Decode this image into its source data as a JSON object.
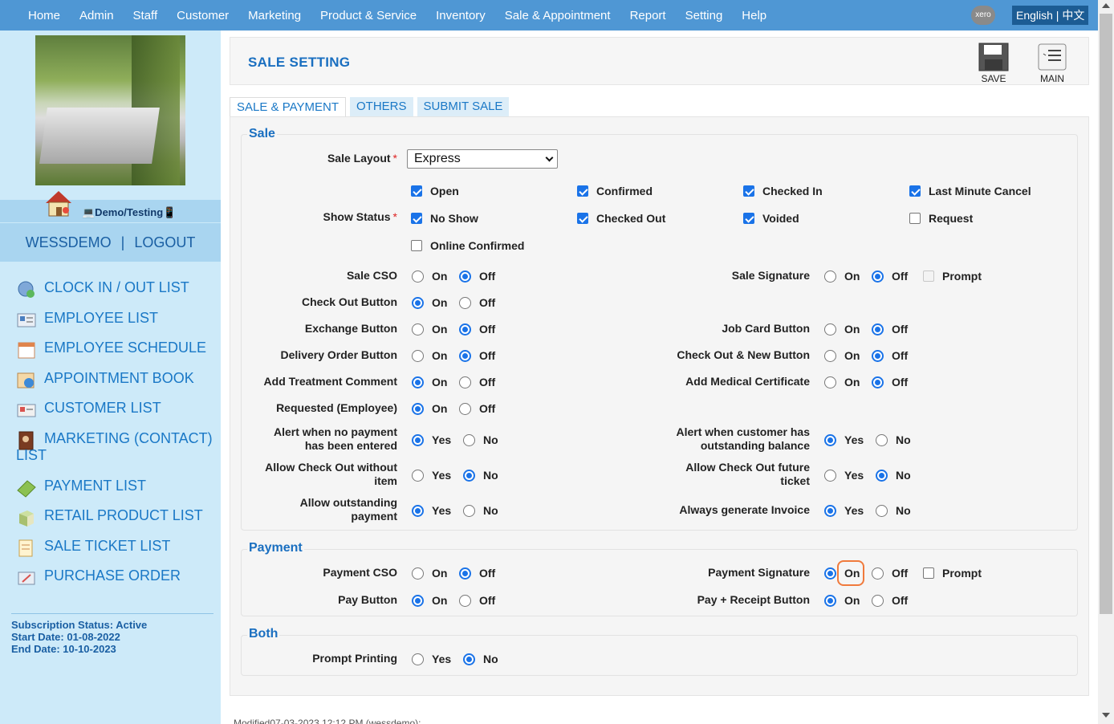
{
  "nav": {
    "items": [
      "Home",
      "Admin",
      "Staff",
      "Customer",
      "Marketing",
      "Product & Service",
      "Inventory",
      "Sale & Appointment",
      "Report",
      "Setting",
      "Help"
    ],
    "xero": "xero",
    "language": "English | 中文"
  },
  "sidebar": {
    "demo_label": "💻Demo/Testing📱",
    "user": "WESSDEMO",
    "separator": "|",
    "logout": "LOGOUT",
    "menu": [
      "CLOCK IN / OUT LIST",
      "EMPLOYEE LIST",
      "EMPLOYEE SCHEDULE",
      "APPOINTMENT BOOK",
      "CUSTOMER LIST",
      "MARKETING (CONTACT) LIST",
      "PAYMENT LIST",
      "RETAIL PRODUCT LIST",
      "SALE TICKET LIST",
      "PURCHASE ORDER"
    ],
    "subscription_status": "Subscription Status: Active",
    "start_date": "Start Date: 01-08-2022",
    "end_date": "End Date: 10-10-2023"
  },
  "header": {
    "title": "SALE SETTING",
    "save": "SAVE",
    "main": "MAIN"
  },
  "tabs": [
    "SALE & PAYMENT",
    "OTHERS",
    "SUBMIT SALE"
  ],
  "sale": {
    "legend": "Sale",
    "layout_label": "Sale Layout",
    "req": "*",
    "layout_value": "Express",
    "status_label": "Show Status",
    "statuses": [
      {
        "label": "Open",
        "checked": true
      },
      {
        "label": "Confirmed",
        "checked": true
      },
      {
        "label": "Checked In",
        "checked": true
      },
      {
        "label": "Last Minute Cancel",
        "checked": true
      },
      {
        "label": "No Show",
        "checked": true
      },
      {
        "label": "Checked Out",
        "checked": true
      },
      {
        "label": "Voided",
        "checked": true
      },
      {
        "label": "Request",
        "checked": false
      },
      {
        "label": "Online Confirmed",
        "checked": false
      }
    ],
    "rows": [
      {
        "label": "Sale CSO",
        "a": "On",
        "b": "Off",
        "sel": "b"
      },
      {
        "label": "Check Out Button",
        "a": "On",
        "b": "Off",
        "sel": "a"
      },
      {
        "label": "Exchange Button",
        "a": "On",
        "b": "Off",
        "sel": "b"
      },
      {
        "label": "Delivery Order Button",
        "a": "On",
        "b": "Off",
        "sel": "b"
      },
      {
        "label": "Add Treatment Comment",
        "a": "On",
        "b": "Off",
        "sel": "a"
      },
      {
        "label": "Requested (Employee)",
        "a": "On",
        "b": "Off",
        "sel": "a"
      },
      {
        "label1": "Alert when no payment",
        "label2": "has been entered",
        "a": "Yes",
        "b": "No",
        "sel": "a"
      },
      {
        "label1": "Allow Check Out without",
        "label2": "item",
        "a": "Yes",
        "b": "No",
        "sel": "b"
      },
      {
        "label1": "Allow outstanding",
        "label2": "payment",
        "a": "Yes",
        "b": "No",
        "sel": "a"
      }
    ],
    "right_rows": [
      {
        "label": "Sale Signature",
        "a": "On",
        "b": "Off",
        "sel": "b",
        "prompt": "Prompt"
      },
      {
        "label": "Job Card Button",
        "a": "On",
        "b": "Off",
        "sel": "b"
      },
      {
        "label": "Check Out & New Button",
        "a": "On",
        "b": "Off",
        "sel": "b"
      },
      {
        "label": "Add Medical Certificate",
        "a": "On",
        "b": "Off",
        "sel": "b"
      },
      {
        "label1": "Alert when customer has",
        "label2": "outstanding balance",
        "a": "Yes",
        "b": "No",
        "sel": "a"
      },
      {
        "label1": "Allow Check Out future",
        "label2": "ticket",
        "a": "Yes",
        "b": "No",
        "sel": "b"
      },
      {
        "label": "Always generate Invoice",
        "a": "Yes",
        "b": "No",
        "sel": "a"
      }
    ]
  },
  "payment": {
    "legend": "Payment",
    "rows": [
      {
        "label": "Payment CSO",
        "a": "On",
        "b": "Off",
        "sel": "b"
      },
      {
        "label": "Pay Button",
        "a": "On",
        "b": "Off",
        "sel": "a"
      }
    ],
    "right_rows": [
      {
        "label": "Payment Signature",
        "a": "On",
        "b": "Off",
        "sel": "a",
        "prompt": "Prompt"
      },
      {
        "label": "Pay + Receipt Button",
        "a": "On",
        "b": "Off",
        "sel": "a"
      }
    ]
  },
  "both": {
    "legend": "Both",
    "rows": [
      {
        "label": "Prompt Printing",
        "a": "Yes",
        "b": "No",
        "sel": "b"
      }
    ]
  },
  "footer": {
    "modified": "Modified07-03-2023 12:12 PM (wessdemo):"
  }
}
